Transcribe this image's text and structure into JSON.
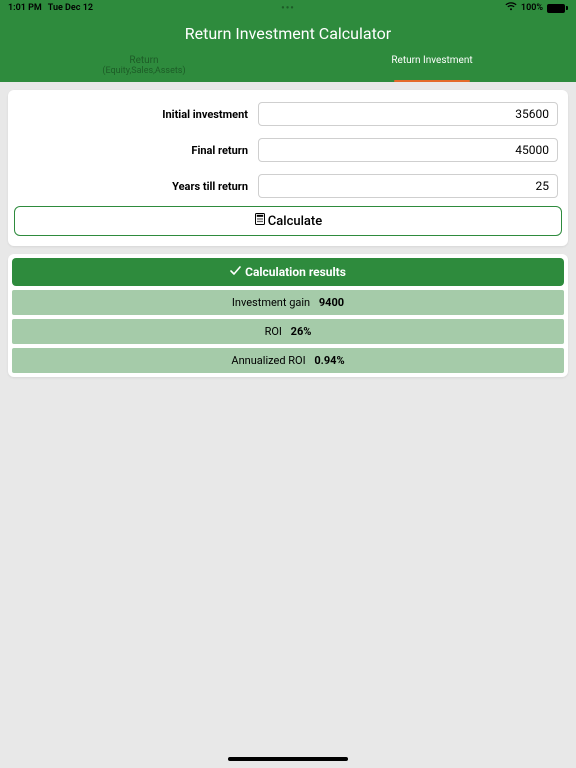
{
  "status": {
    "time": "1:01 PM",
    "date": "Tue Dec 12",
    "battery": "100%"
  },
  "header": {
    "title": "Return Investment Calculator"
  },
  "tabs": {
    "inactive": {
      "line1": "Return",
      "line2": "(Equity,Sales,Assets)"
    },
    "active": {
      "label": "Return Investment"
    }
  },
  "form": {
    "initial_label": "Initial investment",
    "initial_value": "35600",
    "final_label": "Final return",
    "final_value": "45000",
    "years_label": "Years till return",
    "years_value": "25"
  },
  "calc_label": "Calculate",
  "results": {
    "header": "Calculation results",
    "gain_label": "Investment gain",
    "gain_value": "9400",
    "roi_label": "ROI",
    "roi_value": "26%",
    "ann_label": "Annualized ROI",
    "ann_value": "0.94%"
  }
}
